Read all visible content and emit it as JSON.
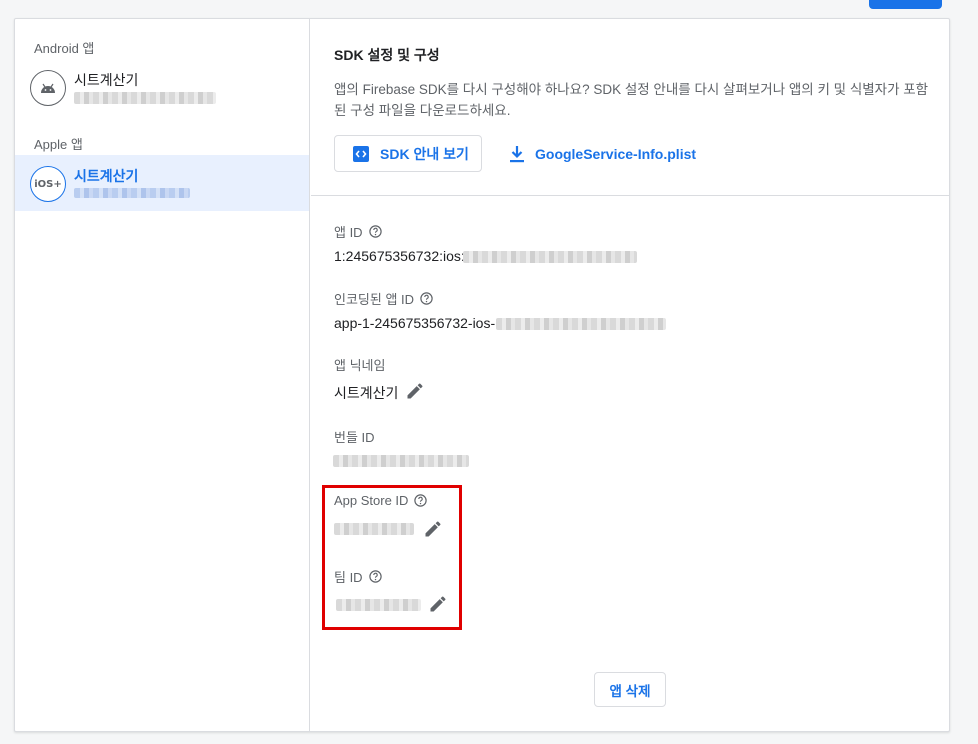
{
  "sidebar": {
    "android_label": "Android 앱",
    "apple_label": "Apple 앱",
    "android_app": {
      "name": "시트계산기",
      "icon": "android-icon"
    },
    "apple_app": {
      "name": "시트계산기",
      "icon": "ios-icon",
      "icon_text": "iOS+"
    }
  },
  "sdk": {
    "title": "SDK 설정 및 구성",
    "description": "앱의 Firebase SDK를 다시 구성해야 하나요? SDK 설정 안내를 다시 살펴보거나 앱의 키 및 식별자가 포함된 구성 파일을 다운로드하세요.",
    "guide_button": "SDK 안내 보기",
    "download_link": "GoogleService-Info.plist"
  },
  "fields": {
    "app_id_label": "앱 ID",
    "app_id_value": "1:245675356732:ios:",
    "encoded_app_id_label": "인코딩된 앱 ID",
    "encoded_app_id_value": "app-1-245675356732-ios-",
    "nickname_label": "앱 닉네임",
    "nickname_value": "시트계산기",
    "bundle_id_label": "번들 ID",
    "app_store_id_label": "App Store ID",
    "team_id_label": "팀 ID"
  },
  "delete_button": "앱 삭제",
  "colors": {
    "accent": "#1a73e8",
    "highlight": "#e00000",
    "selected_bg": "#e8f0fe"
  }
}
